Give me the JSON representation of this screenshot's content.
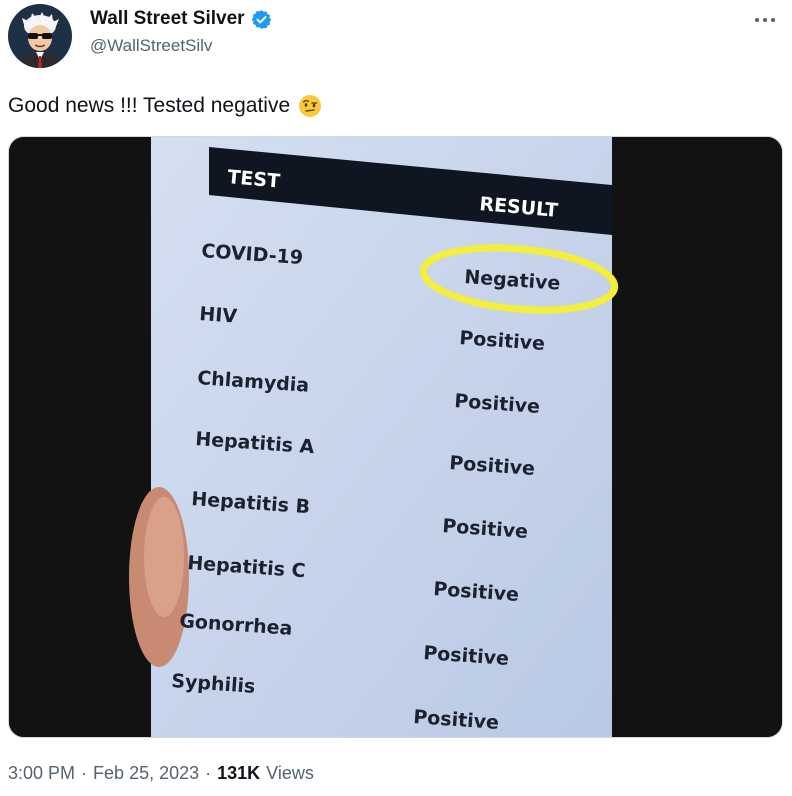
{
  "user": {
    "display_name": "Wall Street Silver",
    "handle": "@WallStreetSilv",
    "verified": true
  },
  "tweet": {
    "text": "Good news !!! Tested negative",
    "emoji": "face-with-raised-eyebrow"
  },
  "media": {
    "document": {
      "header_test": "TEST",
      "header_result": "RESULT",
      "rows": [
        {
          "test": "COVID-19",
          "result": "Negative"
        },
        {
          "test": "HIV",
          "result": "Positive"
        },
        {
          "test": "Chlamydia",
          "result": "Positive"
        },
        {
          "test": "Hepatitis A",
          "result": "Positive"
        },
        {
          "test": "Hepatitis B",
          "result": "Positive"
        },
        {
          "test": "Hepatitis C",
          "result": "Positive"
        },
        {
          "test": "Gonorrhea",
          "result": "Positive"
        },
        {
          "test": "Syphilis",
          "result": "Positive"
        }
      ],
      "highlight_color": "#f3ef3c"
    }
  },
  "meta": {
    "time": "3:00 PM",
    "separator": "·",
    "date": "Feb 25, 2023",
    "views_count": "131K",
    "views_label": "Views"
  },
  "colors": {
    "verified_blue": "#1d9bf0",
    "secondary_text": "#536471",
    "primary_text": "#0f1419"
  }
}
